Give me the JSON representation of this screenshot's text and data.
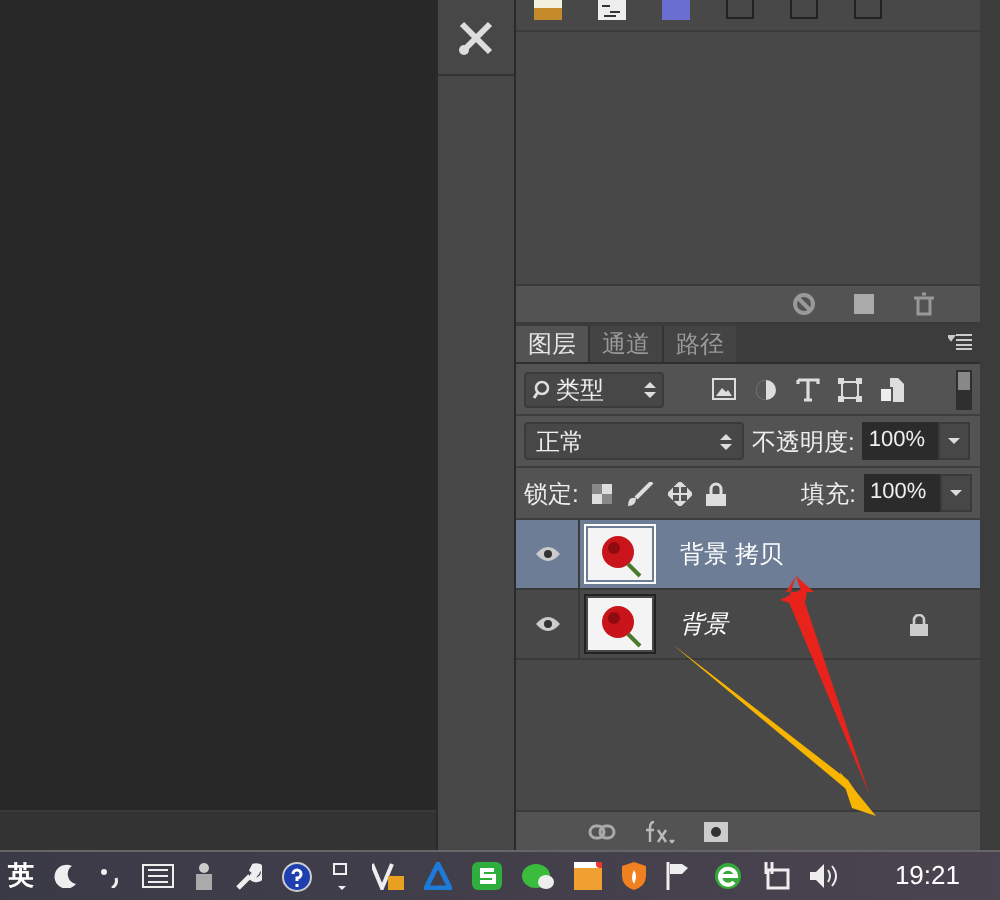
{
  "layers_panel": {
    "tabs": [
      {
        "label": "图层",
        "selected": true
      },
      {
        "label": "通道",
        "selected": false
      },
      {
        "label": "路径",
        "selected": false
      }
    ],
    "filter": {
      "value": "类型"
    },
    "blend_mode": {
      "value": "正常"
    },
    "opacity": {
      "label": "不透明度:",
      "value": "100%"
    },
    "lock": {
      "label": "锁定:"
    },
    "fill": {
      "label": "填充:",
      "value": "100%"
    },
    "layers": [
      {
        "name": "背景 拷贝",
        "visible": true,
        "selected": true,
        "locked": false,
        "kind": "normal"
      },
      {
        "name": "背景",
        "visible": true,
        "selected": false,
        "locked": true,
        "kind": "background"
      }
    ]
  },
  "taskbar": {
    "ime": "英",
    "clock": "19:21"
  }
}
